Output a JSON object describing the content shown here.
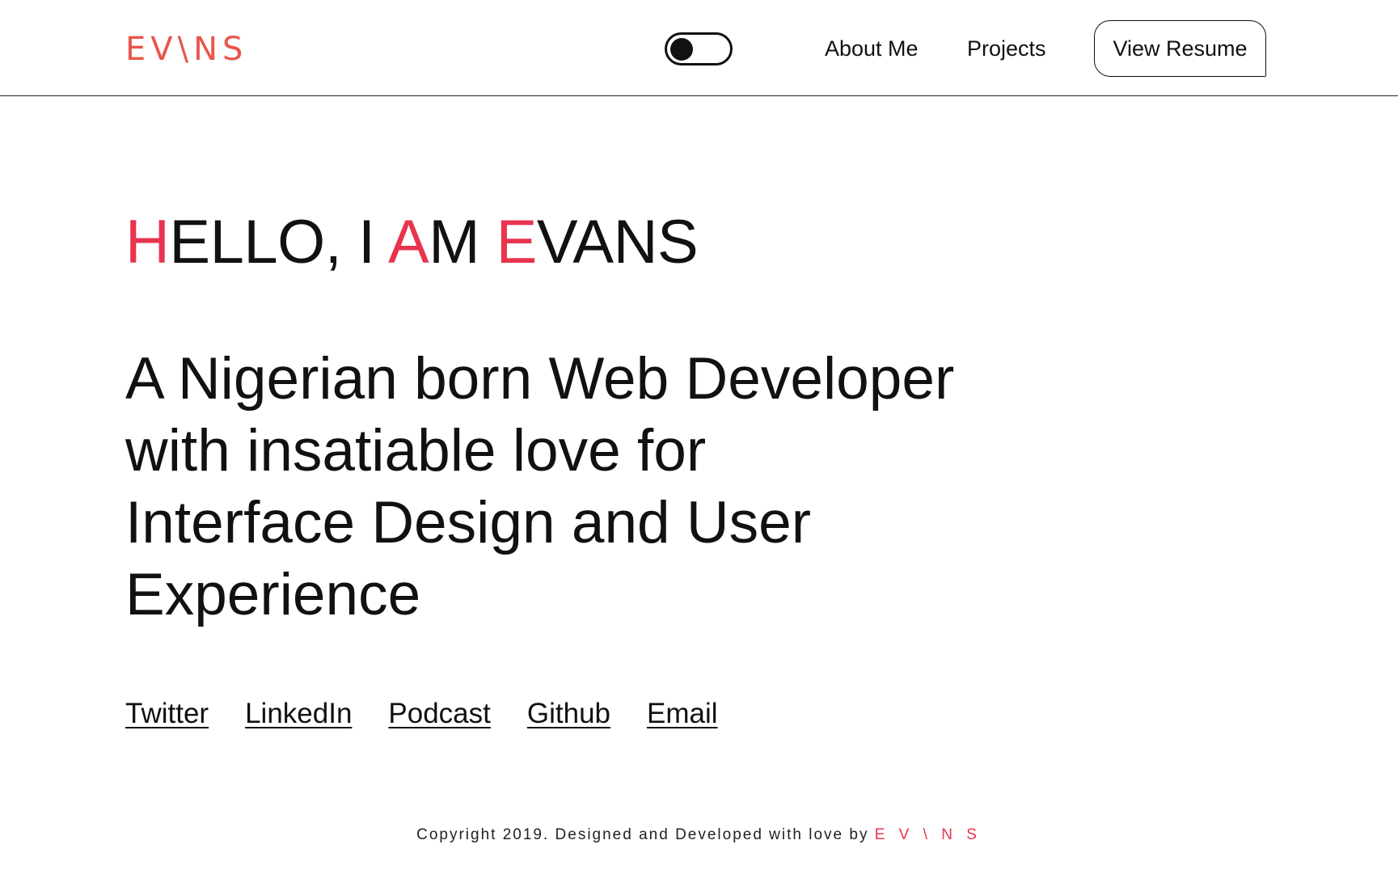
{
  "header": {
    "logo_text": "EV\\NS",
    "theme_toggle": "dark-mode-toggle",
    "nav": {
      "about_label": "About Me",
      "projects_label": "Projects"
    },
    "resume_label": "View Resume"
  },
  "hero": {
    "title_parts": [
      "H",
      "ELLO, I ",
      "A",
      "M ",
      "E",
      "VANS"
    ],
    "tagline_lines": [
      "A Nigerian born Web Developer",
      "with insatiable love for",
      "Interface Design and User",
      "Experience"
    ]
  },
  "social_links": [
    "Twitter",
    "LinkedIn",
    "Podcast",
    "Github",
    "Email"
  ],
  "footer": {
    "text": "Copyright 2019. Designed and Developed with love by ",
    "brand": "E V \\ N S"
  },
  "colors": {
    "accent": "#e8344e",
    "logo": "#e8564a",
    "text": "#111111"
  }
}
